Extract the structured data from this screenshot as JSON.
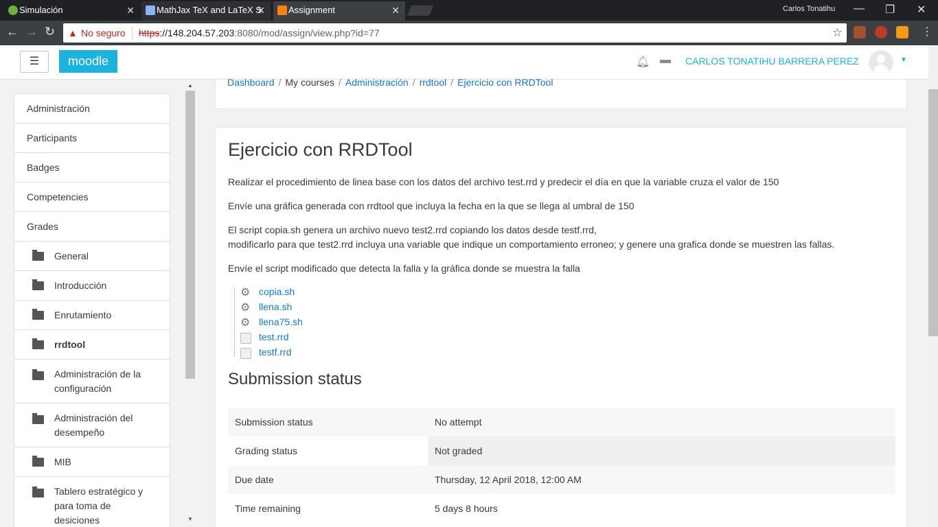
{
  "browser": {
    "tabs": [
      {
        "title": "Simulación",
        "icon": "spring-leaf-icon",
        "icon_color": "#6db33f"
      },
      {
        "title": "MathJax TeX and LaTeX S",
        "icon": "document-grid-icon",
        "icon_color": "#8ab4f8"
      },
      {
        "title": "Assignment",
        "icon": "moodle-icon",
        "icon_color": "#f98012"
      }
    ],
    "window_user": "Carlos Tonatihu",
    "security_label": "No seguro",
    "url_scheme": "https",
    "url_host": "://148.204.57.203",
    "url_rest": ":8080/mod/assign/view.php?id=77"
  },
  "navbar": {
    "menu_icon": "☰",
    "logo": "moodle",
    "user_name": "CARLOS TONATIHU BARRERA PEREZ",
    "accent": "#1ab2de"
  },
  "breadcrumb": [
    {
      "label": "Dashboard",
      "link": true
    },
    {
      "label": "My courses",
      "link": false
    },
    {
      "label": "Administración",
      "link": true
    },
    {
      "label": "rrdtool",
      "link": true
    },
    {
      "label": "Ejercicio con RRDTool",
      "link": true
    }
  ],
  "sidebar": {
    "items": [
      {
        "label": "Administración",
        "folder": false
      },
      {
        "label": "Participants",
        "folder": false
      },
      {
        "label": "Badges",
        "folder": false
      },
      {
        "label": "Competencies",
        "folder": false
      },
      {
        "label": "Grades",
        "folder": false
      },
      {
        "label": "General",
        "folder": true
      },
      {
        "label": "Introducción",
        "folder": true
      },
      {
        "label": "Enrutamiento",
        "folder": true
      },
      {
        "label": "rrdtool",
        "folder": true,
        "active": true
      },
      {
        "label": "Administración de la configuración",
        "folder": true
      },
      {
        "label": "Administración del desempeño",
        "folder": true
      },
      {
        "label": "MIB",
        "folder": true
      },
      {
        "label": "Tablero estratégico y para toma de desiciones",
        "folder": true
      }
    ]
  },
  "assignment": {
    "title": "Ejercicio con RRDTool",
    "paragraphs": [
      "Realizar el procedimiento de linea base con los datos del archivo test.rrd y predecir el día en que la variable cruza el valor de 150",
      "Envíe una gráfica generada con rrdtool que incluya la fecha en la que se llega al umbral de 150",
      "El script copia.sh genera un archivo nuevo test2.rrd copiando los datos desde testf.rrd,",
      "modificarlo para que test2.rrd incluya una variable que indique un comportamiento erroneo; y genere una grafica donde se muestren las fallas.",
      "Envíe el script modificado que detecta la falla y la gráfica donde se muestra la falla"
    ],
    "files": [
      {
        "name": "copia.sh",
        "icon": "gear-icon"
      },
      {
        "name": "llena.sh",
        "icon": "gear-icon"
      },
      {
        "name": "llena75.sh",
        "icon": "gear-icon"
      },
      {
        "name": "test.rrd",
        "icon": "document-icon"
      },
      {
        "name": "testf.rrd",
        "icon": "document-icon"
      }
    ]
  },
  "submission": {
    "heading": "Submission status",
    "rows": [
      {
        "label": "Submission status",
        "value": "No attempt"
      },
      {
        "label": "Grading status",
        "value": "Not graded"
      },
      {
        "label": "Due date",
        "value": "Thursday, 12 April 2018, 12:00 AM"
      },
      {
        "label": "Time remaining",
        "value": "5 days 8 hours"
      }
    ]
  }
}
